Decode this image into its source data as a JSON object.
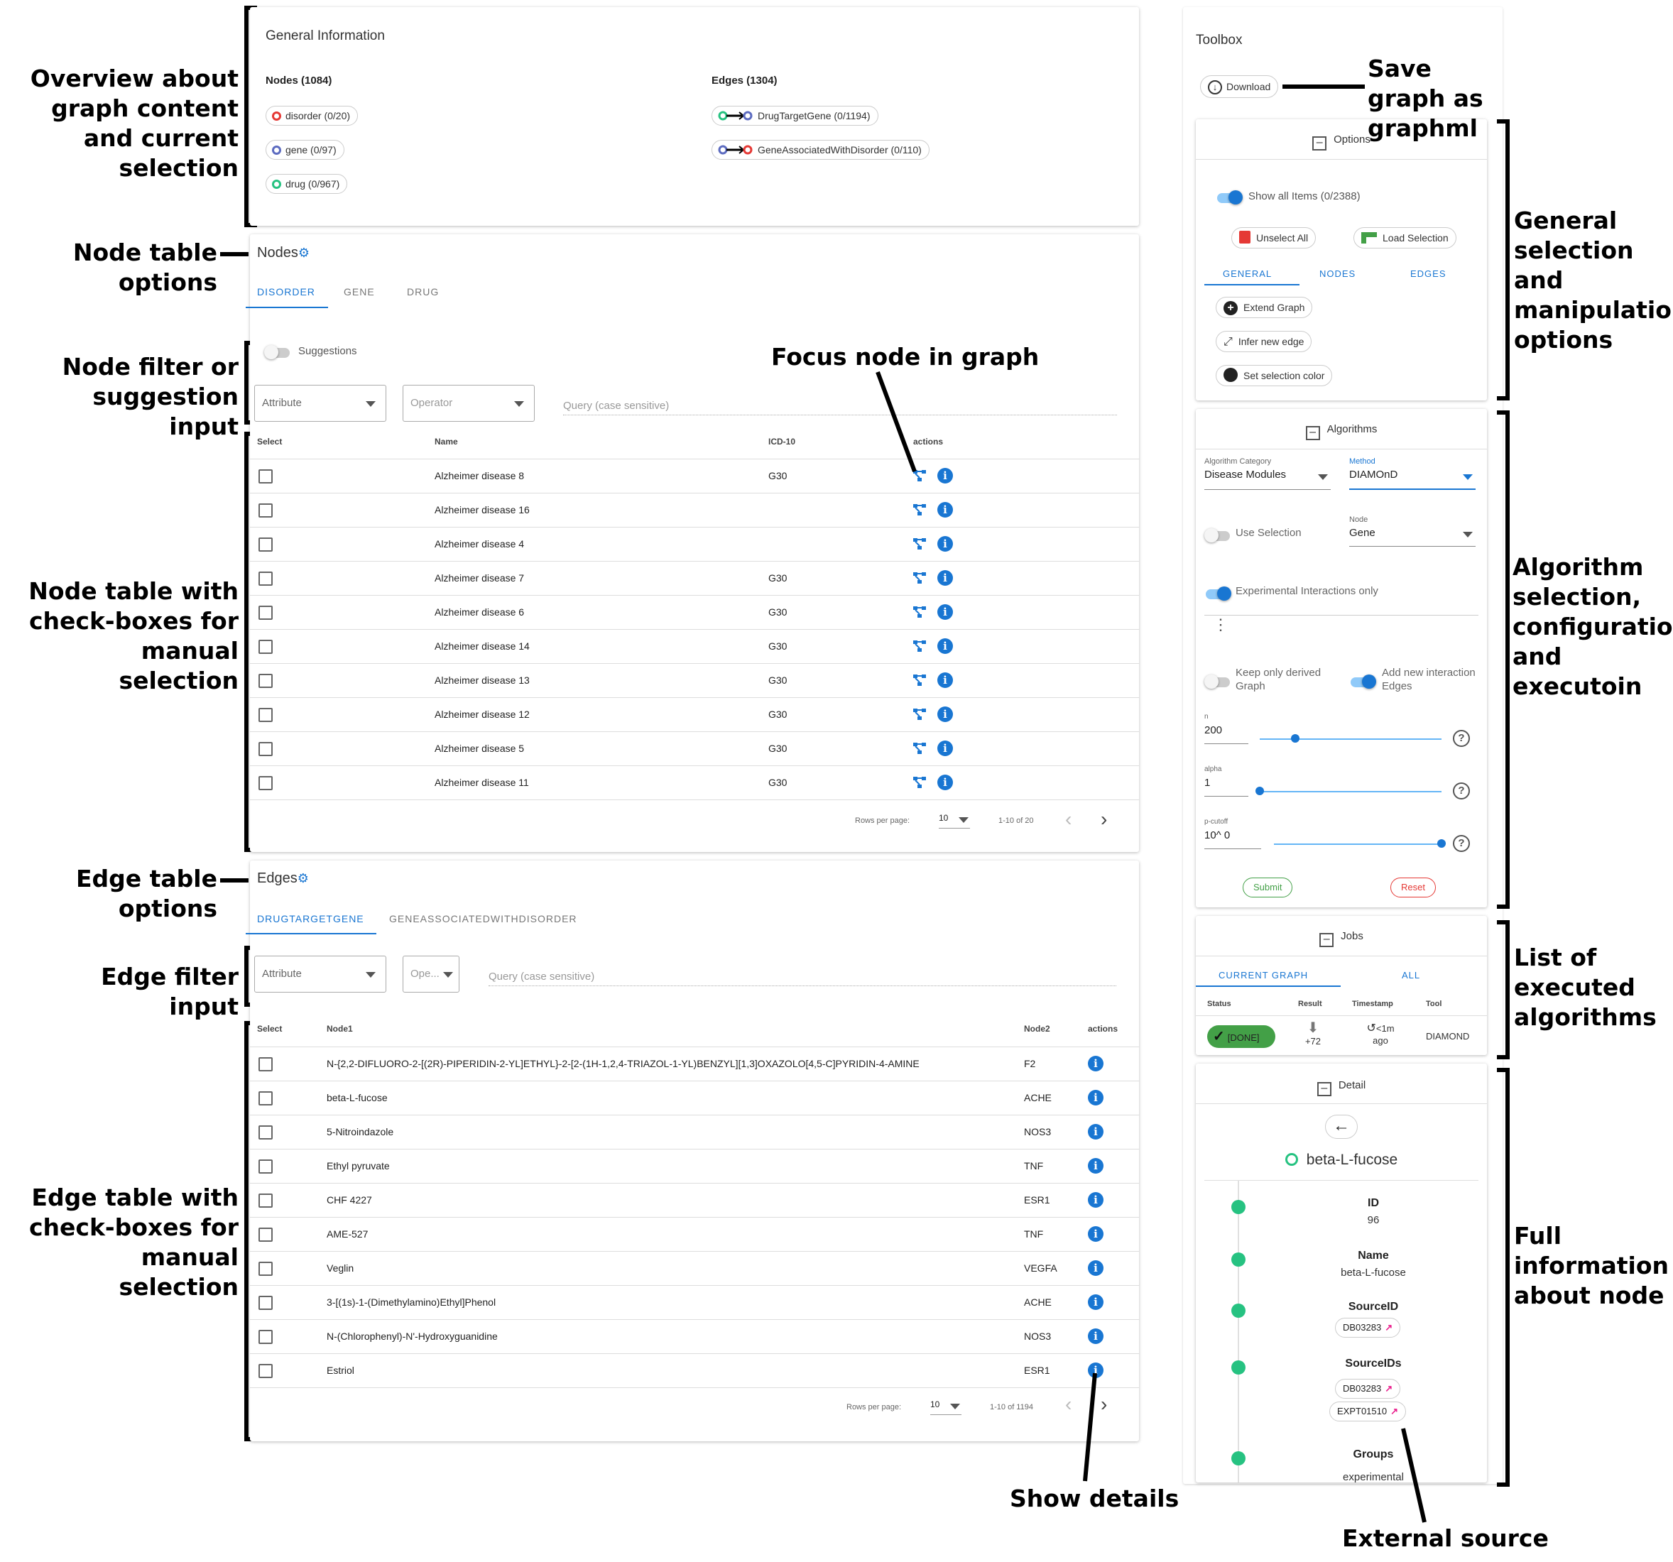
{
  "annotations": {
    "overview": "Overview about graph content and current selection",
    "node_table_options": "Node table options",
    "node_filter": "Node filter or suggestion input",
    "focus_node": "Focus node in graph",
    "node_table": "Node table with check-boxes for manual selection",
    "edge_table_options": "Edge table options",
    "edge_filter": "Edge filter input",
    "edge_table": "Edge table with check-boxes for manual selection",
    "show_details": "Show details",
    "external_source": "External source",
    "save_graph": "Save graph as graphml",
    "general_selection": "General selection and manipulation options",
    "algorithm_selection": "Algorithm selection, configuration and executoin",
    "executed_algorithms": "List of executed algorithms",
    "full_info": "Full information about node"
  },
  "general_info": {
    "title": "General Information",
    "nodes_header": "Nodes (1084)",
    "edges_header": "Edges (1304)",
    "node_types": [
      {
        "label": "disorder (0/20)",
        "color": "#e53935"
      },
      {
        "label": "gene (0/97)",
        "color": "#5c6bc0"
      },
      {
        "label": "drug (0/967)",
        "color": "#26c281"
      }
    ],
    "edge_types": [
      {
        "label": "DrugTargetGene (0/1194)"
      },
      {
        "label": "GeneAssociatedWithDisorder (0/110)"
      }
    ]
  },
  "nodes": {
    "title": "Nodes",
    "tabs": [
      "DISORDER",
      "GENE",
      "DRUG"
    ],
    "suggestions_label": "Suggestions",
    "attribute_placeholder": "Attribute",
    "operator_placeholder": "Operator",
    "query_placeholder": "Query (case sensitive)",
    "columns": [
      "Select",
      "Name",
      "ICD-10",
      "actions"
    ],
    "rows": [
      {
        "name": "Alzheimer disease 8",
        "icd": "G30"
      },
      {
        "name": "Alzheimer disease 16",
        "icd": ""
      },
      {
        "name": "Alzheimer disease 4",
        "icd": ""
      },
      {
        "name": "Alzheimer disease 7",
        "icd": "G30"
      },
      {
        "name": "Alzheimer disease 6",
        "icd": "G30"
      },
      {
        "name": "Alzheimer disease 14",
        "icd": "G30"
      },
      {
        "name": "Alzheimer disease 13",
        "icd": "G30"
      },
      {
        "name": "Alzheimer disease 12",
        "icd": "G30"
      },
      {
        "name": "Alzheimer disease 5",
        "icd": "G30"
      },
      {
        "name": "Alzheimer disease 11",
        "icd": "G30"
      }
    ],
    "rows_per_page_label": "Rows per page:",
    "rows_per_page": "10",
    "range": "1-10 of 20"
  },
  "edges": {
    "title": "Edges",
    "tabs": [
      "DRUGTARGETGENE",
      "GENEASSOCIATEDWITHDISORDER"
    ],
    "attribute_placeholder": "Attribute",
    "operator_placeholder": "Ope...",
    "query_placeholder": "Query (case sensitive)",
    "columns": [
      "Select",
      "Node1",
      "Node2",
      "actions"
    ],
    "rows": [
      {
        "node1": "N-{2,2-DIFLUORO-2-[(2R)-PIPERIDIN-2-YL]ETHYL}-2-[2-(1H-1,2,4-TRIAZOL-1-YL)BENZYL][1,3]OXAZOLO[4,5-C]PYRIDIN-4-AMINE",
        "node2": "F2"
      },
      {
        "node1": "beta-L-fucose",
        "node2": "ACHE"
      },
      {
        "node1": "5-Nitroindazole",
        "node2": "NOS3"
      },
      {
        "node1": "Ethyl pyruvate",
        "node2": "TNF"
      },
      {
        "node1": "CHF 4227",
        "node2": "ESR1"
      },
      {
        "node1": "AME-527",
        "node2": "TNF"
      },
      {
        "node1": "Veglin",
        "node2": "VEGFA"
      },
      {
        "node1": "3-[(1s)-1-(Dimethylamino)Ethyl]Phenol",
        "node2": "ACHE"
      },
      {
        "node1": "N-(Chlorophenyl)-N'-Hydroxyguanidine",
        "node2": "NOS3"
      },
      {
        "node1": "Estriol",
        "node2": "ESR1"
      }
    ],
    "rows_per_page_label": "Rows per page:",
    "rows_per_page": "10",
    "range": "1-10 of 1194"
  },
  "toolbox": {
    "title": "Toolbox",
    "download_label": "Download",
    "options": {
      "title": "Options",
      "show_all": "Show all Items (0/2388)",
      "unselect_all": "Unselect All",
      "load_selection": "Load Selection",
      "tabs": [
        "GENERAL",
        "NODES",
        "EDGES"
      ],
      "extend_graph": "Extend Graph",
      "infer_edge": "Infer new edge",
      "set_color": "Set selection color"
    },
    "algorithms": {
      "title": "Algorithms",
      "category_label": "Algorithm Category",
      "category_value": "Disease Modules",
      "method_label": "Method",
      "method_value": "DIAMOnD",
      "use_selection": "Use Selection",
      "node_label": "Node",
      "node_value": "Gene",
      "experimental_only": "Experimental Interactions only",
      "keep_derived": "Keep only derived Graph",
      "add_edges": "Add new interaction Edges",
      "n_label": "n",
      "n_value": "200",
      "n_fraction": 0.14,
      "alpha_label": "alpha",
      "alpha_value": "1",
      "alpha_fraction": 0.0,
      "pcutoff_label": "p-cutoff",
      "pcutoff_value": "10^ 0",
      "pcutoff_fraction": 1.0,
      "submit": "Submit",
      "reset": "Reset"
    },
    "jobs": {
      "title": "Jobs",
      "tabs": [
        "CURRENT GRAPH",
        "ALL"
      ],
      "columns": [
        "Status",
        "Result",
        "Timestamp",
        "Tool"
      ],
      "row": {
        "status": "[DONE]",
        "result": "+72",
        "timestamp_1": "<1m",
        "timestamp_2": "ago",
        "tool": "DIAMOND"
      }
    },
    "detail": {
      "title": "Detail",
      "node_name": "beta-L-fucose",
      "fields": {
        "id_label": "ID",
        "id_value": "96",
        "name_label": "Name",
        "name_value": "beta-L-fucose",
        "sourceid_label": "SourceID",
        "sourceid_value": "DB03283",
        "sourceids_label": "SourceIDs",
        "sourceids_1": "DB03283",
        "sourceids_2": "EXPT01510",
        "groups_label": "Groups",
        "groups_value": "experimental"
      }
    }
  },
  "colors": {
    "accent": "#1976d2",
    "drug": "#26c281",
    "disorder": "#e53935",
    "gene": "#5c6bc0",
    "done": "#43a047",
    "reset": "#e53935"
  }
}
